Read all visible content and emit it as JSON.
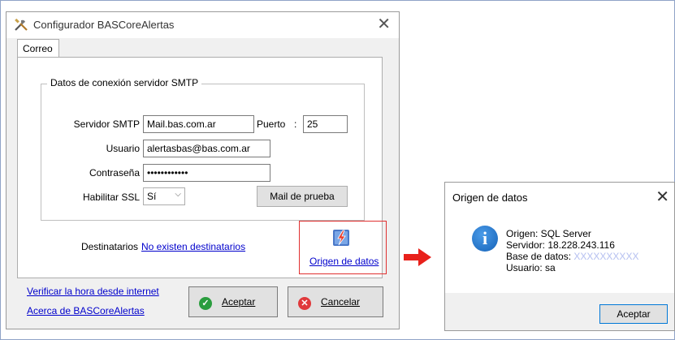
{
  "main_window": {
    "title": "Configurador BASCoreAlertas",
    "close_glyph": "✕",
    "tab_label": "Correo",
    "group_title": "Datos de conexión servidor SMTP",
    "smtp_server": {
      "label": "Servidor SMTP",
      "value": "Mail.bas.com.ar"
    },
    "port": {
      "label": "Puerto",
      "separator": ":",
      "value": "25"
    },
    "user": {
      "label": "Usuario",
      "value": "alertasbas@bas.com.ar"
    },
    "password": {
      "label": "Contraseña",
      "value": "••••••••••••"
    },
    "ssl": {
      "label": "Habilitar SSL",
      "value": "Sí"
    },
    "test_mail_button": "Mail de prueba",
    "recipients_label": "Destinatarios",
    "recipients_link": "No existen destinatarios",
    "data_source_link": "Origen de datos",
    "verify_time_link": "Verificar la hora desde internet",
    "about_link": "Acerca de BASCoreAlertas",
    "accept_button": "Aceptar",
    "cancel_button": "Cancelar"
  },
  "dialog": {
    "title": "Origen de datos",
    "close_glyph": "✕",
    "origin_line": "Origen: SQL Server",
    "server_line": "Servidor: 18.228.243.116",
    "database_label": "Base de datos:",
    "database_value": "XXXXXXXXXX",
    "user_line": "Usuario: sa",
    "accept_button": "Aceptar"
  },
  "colors": {
    "link": "#0000cc",
    "highlight_border": "#e03030",
    "arrow": "#e8211b",
    "accept_icon": "#2a9d3e",
    "cancel_icon": "#e0393b",
    "info_icon": "#1a6fd0",
    "masked_text": "#b4bff0"
  },
  "icons": {
    "app": "tools-icon",
    "data_source": "database-lightning-icon",
    "accept": "check-circle-icon",
    "cancel": "x-circle-icon",
    "info": "info-icon",
    "arrow": "arrow-right-icon",
    "ssl_dropdown": "chevron-down-icon"
  }
}
